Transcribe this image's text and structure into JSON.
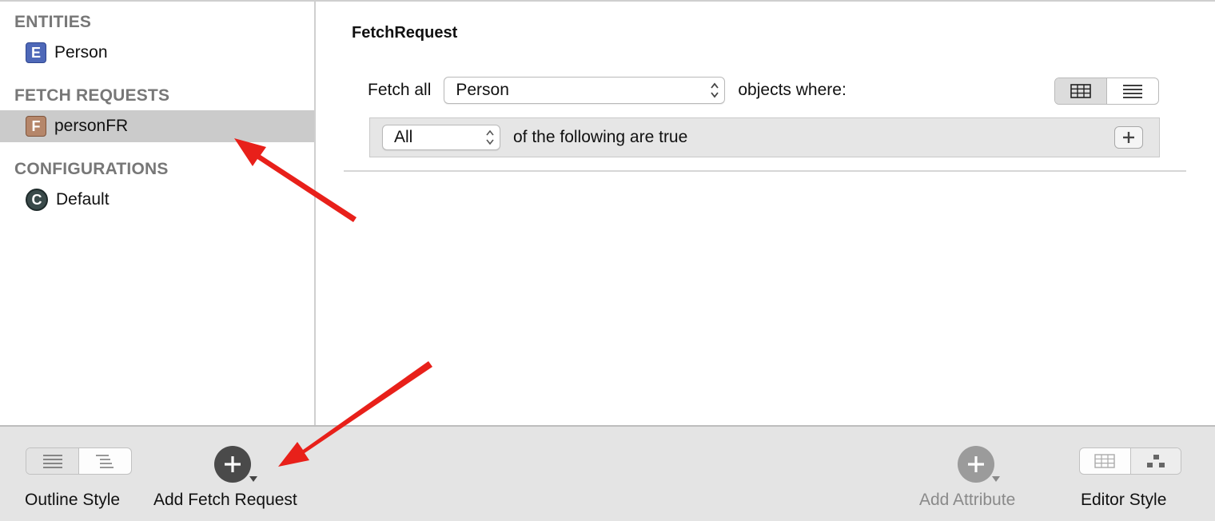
{
  "sidebar": {
    "entities_title": "ENTITIES",
    "entities": [
      {
        "badge": "E",
        "label": "Person"
      }
    ],
    "fetch_title": "FETCH REQUESTS",
    "fetch_requests": [
      {
        "badge": "F",
        "label": "personFR",
        "selected": true
      }
    ],
    "config_title": "CONFIGURATIONS",
    "configurations": [
      {
        "badge": "C",
        "label": "Default"
      }
    ]
  },
  "main": {
    "title": "FetchRequest",
    "fetch_all_label": "Fetch all",
    "entity_value": "Person",
    "objects_where_label": "objects where:",
    "predicate_value": "All",
    "predicate_text": "of the following are true"
  },
  "toolbar": {
    "outline_style_label": "Outline Style",
    "add_fetch_request_label": "Add Fetch Request",
    "add_attribute_label": "Add Attribute",
    "editor_style_label": "Editor Style"
  },
  "colors": {
    "entity_badge": "#4e68b8",
    "fetch_badge": "#b5866a",
    "config_badge": "#3a4a4a",
    "selection": "#cbcbcb",
    "annotation_arrow": "#e8201a"
  }
}
